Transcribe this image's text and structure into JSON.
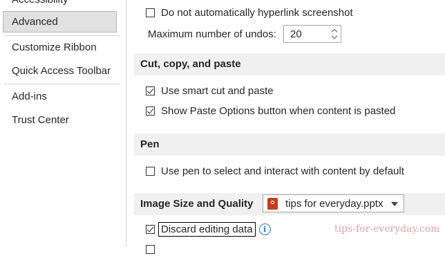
{
  "sidebar": {
    "items": [
      {
        "label": "Accessibility"
      },
      {
        "label": "Advanced",
        "selected": true
      },
      {
        "label": "Customize Ribbon"
      },
      {
        "label": "Quick Access Toolbar"
      },
      {
        "label": "Add-ins"
      },
      {
        "label": "Trust Center"
      }
    ]
  },
  "main": {
    "screenshot_option": {
      "label": "Do not automatically hyperlink screenshot",
      "checked": false
    },
    "undos": {
      "label": "Maximum number of undos:",
      "value": "20"
    },
    "cut_copy_paste": {
      "header": "Cut, copy, and paste",
      "smart_cut": {
        "label": "Use smart cut and paste",
        "checked": true
      },
      "paste_options": {
        "label": "Show Paste Options button when content is pasted",
        "checked": true
      }
    },
    "pen": {
      "header": "Pen",
      "use_pen": {
        "label": "Use pen to select and interact with content by default",
        "checked": false
      }
    },
    "image_quality": {
      "header": "Image Size and Quality",
      "file_select": {
        "value": "tips for everyday.pptx",
        "icon": "powerpoint-file-icon"
      },
      "discard_editing": {
        "label": "Discard editing data",
        "checked": true
      }
    }
  },
  "watermark": "tips-for-everyday.com",
  "colors": {
    "selected_bg": "#e1e1e1",
    "section_bg": "#f0f0f0",
    "info_blue": "#2b78c6",
    "ppt_red": "#c43e1c"
  }
}
